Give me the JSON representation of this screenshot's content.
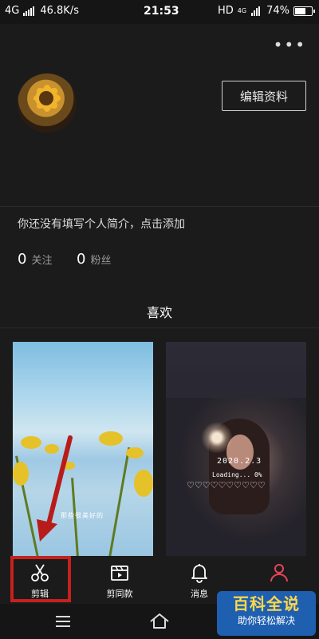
{
  "status_bar": {
    "network": "4G",
    "speed": "46.8K/s",
    "time": "21:53",
    "hd": "HD",
    "net_right": "4G",
    "battery": "74%",
    "battery_level": 0.74
  },
  "profile": {
    "more_label": "•••",
    "edit_button": "编辑资料",
    "bio": "你还没有填写个人简介，点击添加",
    "following_count": "0",
    "following_label": "关注",
    "followers_count": "0",
    "followers_label": "粉丝",
    "liked_tab": "喜欢"
  },
  "thumbnails": [
    {
      "caption": "那些很美好的"
    },
    {
      "date": "2020.2.3",
      "loading": "Loading... 0%",
      "hearts": "♡♡♡♡♡♡♡♡♡♡"
    }
  ],
  "bottom_nav": [
    {
      "label": "剪辑",
      "icon": "scissors-icon"
    },
    {
      "label": "剪同款",
      "icon": "clapperboard-icon"
    },
    {
      "label": "消息",
      "icon": "bell-icon"
    },
    {
      "label": "",
      "icon": "person-icon"
    }
  ],
  "accent_colors": {
    "highlight": "#c8201e",
    "profile_tab": "#e8435a"
  },
  "watermark": {
    "main": "百科全说",
    "sub": "助你轻松解决"
  }
}
